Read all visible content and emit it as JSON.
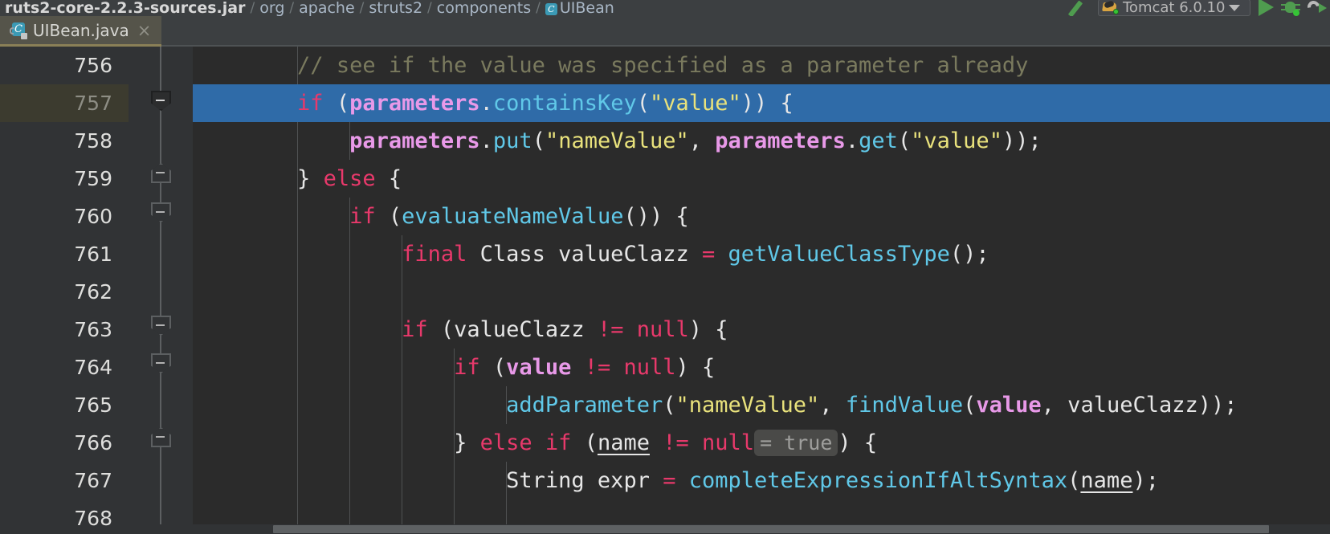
{
  "breadcrumb": {
    "items": [
      {
        "label": "ruts2-core-2.2.3-sources.jar",
        "strong": true,
        "icon": null
      },
      {
        "label": "org",
        "strong": false,
        "icon": null
      },
      {
        "label": "apache",
        "strong": false,
        "icon": null
      },
      {
        "label": "struts2",
        "strong": false,
        "icon": null
      },
      {
        "label": "components",
        "strong": false,
        "icon": null
      },
      {
        "label": "UIBean",
        "strong": false,
        "icon": "java-class-icon"
      }
    ],
    "separator": "/",
    "class_icon_glyph": "C"
  },
  "toolbar": {
    "wrench_icon": "wrench-icon",
    "run_configuration": {
      "label": "Tomcat 6.0.10",
      "icon": "tomcat-icon",
      "dropdown_arrow": "chevron-down-icon"
    },
    "run_button": "run-icon",
    "debug_button": "debug-icon",
    "rerun_button": "rerun-icon"
  },
  "tabs": [
    {
      "label": "UIBean.java",
      "icon": "java-class-readonly-icon",
      "icon_glyph": "C",
      "close": "×",
      "active": true
    }
  ],
  "editor": {
    "first_visible_line": 756,
    "current_line": 757,
    "lines": [
      {
        "number": "756",
        "fold": null,
        "indent_guides": [
          0
        ],
        "current": false,
        "tokens": [
          {
            "t": "        ",
            "c": "p"
          },
          {
            "t": "// see if the value was specified as a parameter already",
            "c": "c"
          }
        ]
      },
      {
        "number": "757",
        "fold": "down-active",
        "indent_guides": [],
        "current": true,
        "tokens": [
          {
            "t": "        ",
            "c": "p"
          },
          {
            "t": "if",
            "c": "k"
          },
          {
            "t": " (",
            "c": "p"
          },
          {
            "t": "parameters",
            "c": "fld"
          },
          {
            "t": ".",
            "c": "p"
          },
          {
            "t": "containsKey",
            "c": "m"
          },
          {
            "t": "(",
            "c": "p"
          },
          {
            "t": "\"value\"",
            "c": "s"
          },
          {
            "t": ")) {",
            "c": "p"
          }
        ]
      },
      {
        "number": "758",
        "fold": null,
        "indent_guides": [
          0,
          1
        ],
        "current": false,
        "tokens": [
          {
            "t": "            ",
            "c": "p"
          },
          {
            "t": "parameters",
            "c": "fld"
          },
          {
            "t": ".",
            "c": "p"
          },
          {
            "t": "put",
            "c": "m"
          },
          {
            "t": "(",
            "c": "p"
          },
          {
            "t": "\"nameValue\"",
            "c": "s"
          },
          {
            "t": ", ",
            "c": "p"
          },
          {
            "t": "parameters",
            "c": "fld"
          },
          {
            "t": ".",
            "c": "p"
          },
          {
            "t": "get",
            "c": "m"
          },
          {
            "t": "(",
            "c": "p"
          },
          {
            "t": "\"value\"",
            "c": "s"
          },
          {
            "t": "));",
            "c": "p"
          }
        ]
      },
      {
        "number": "759",
        "fold": "up",
        "indent_guides": [
          0
        ],
        "current": false,
        "tokens": [
          {
            "t": "        ",
            "c": "p"
          },
          {
            "t": "} ",
            "c": "p"
          },
          {
            "t": "else",
            "c": "k"
          },
          {
            "t": " {",
            "c": "p"
          }
        ]
      },
      {
        "number": "760",
        "fold": "down",
        "indent_guides": [
          0,
          1
        ],
        "current": false,
        "tokens": [
          {
            "t": "            ",
            "c": "p"
          },
          {
            "t": "if",
            "c": "k"
          },
          {
            "t": " (",
            "c": "p"
          },
          {
            "t": "evaluateNameValue",
            "c": "m"
          },
          {
            "t": "()) {",
            "c": "p"
          }
        ]
      },
      {
        "number": "761",
        "fold": null,
        "indent_guides": [
          0,
          1,
          2
        ],
        "current": false,
        "tokens": [
          {
            "t": "                ",
            "c": "p"
          },
          {
            "t": "final",
            "c": "k"
          },
          {
            "t": " Class valueClazz ",
            "c": "p"
          },
          {
            "t": "=",
            "c": "k"
          },
          {
            "t": " ",
            "c": "p"
          },
          {
            "t": "getValueClassType",
            "c": "m"
          },
          {
            "t": "();",
            "c": "p"
          }
        ]
      },
      {
        "number": "762",
        "fold": null,
        "indent_guides": [
          0,
          1,
          2
        ],
        "current": false,
        "tokens": []
      },
      {
        "number": "763",
        "fold": "down",
        "indent_guides": [
          0,
          1,
          2
        ],
        "current": false,
        "tokens": [
          {
            "t": "                ",
            "c": "p"
          },
          {
            "t": "if",
            "c": "k"
          },
          {
            "t": " (valueClazz ",
            "c": "p"
          },
          {
            "t": "!=",
            "c": "k"
          },
          {
            "t": " ",
            "c": "p"
          },
          {
            "t": "null",
            "c": "k"
          },
          {
            "t": ") {",
            "c": "p"
          }
        ]
      },
      {
        "number": "764",
        "fold": "down",
        "indent_guides": [
          0,
          1,
          2,
          3
        ],
        "current": false,
        "tokens": [
          {
            "t": "                    ",
            "c": "p"
          },
          {
            "t": "if",
            "c": "k"
          },
          {
            "t": " (",
            "c": "p"
          },
          {
            "t": "value",
            "c": "fld"
          },
          {
            "t": " ",
            "c": "p"
          },
          {
            "t": "!=",
            "c": "k"
          },
          {
            "t": " ",
            "c": "p"
          },
          {
            "t": "null",
            "c": "k"
          },
          {
            "t": ") {",
            "c": "p"
          }
        ]
      },
      {
        "number": "765",
        "fold": null,
        "indent_guides": [
          0,
          1,
          2,
          3,
          4
        ],
        "current": false,
        "tokens": [
          {
            "t": "                        ",
            "c": "p"
          },
          {
            "t": "addParameter",
            "c": "m"
          },
          {
            "t": "(",
            "c": "p"
          },
          {
            "t": "\"nameValue\"",
            "c": "s"
          },
          {
            "t": ", ",
            "c": "p"
          },
          {
            "t": "findValue",
            "c": "m"
          },
          {
            "t": "(",
            "c": "p"
          },
          {
            "t": "value",
            "c": "fld"
          },
          {
            "t": ", valueClazz));",
            "c": "p"
          }
        ]
      },
      {
        "number": "766",
        "fold": "up",
        "indent_guides": [
          0,
          1,
          2,
          3
        ],
        "current": false,
        "tokens": [
          {
            "t": "                    ",
            "c": "p"
          },
          {
            "t": "} ",
            "c": "p"
          },
          {
            "t": "else",
            "c": "k"
          },
          {
            "t": " ",
            "c": "p"
          },
          {
            "t": "if",
            "c": "k"
          },
          {
            "t": " (",
            "c": "p"
          },
          {
            "t": "name",
            "c": "u"
          },
          {
            "t": " ",
            "c": "p"
          },
          {
            "t": "!=",
            "c": "k"
          },
          {
            "t": " ",
            "c": "p"
          },
          {
            "t": "null",
            "c": "k"
          },
          {
            "t": "= true",
            "c": "hint"
          },
          {
            "t": ") {",
            "c": "p"
          }
        ]
      },
      {
        "number": "767",
        "fold": null,
        "indent_guides": [
          0,
          1,
          2,
          3,
          4
        ],
        "current": false,
        "tokens": [
          {
            "t": "                        ",
            "c": "p"
          },
          {
            "t": "String expr ",
            "c": "p"
          },
          {
            "t": "=",
            "c": "k"
          },
          {
            "t": " ",
            "c": "p"
          },
          {
            "t": "completeExpressionIfAltSyntax",
            "c": "m"
          },
          {
            "t": "(",
            "c": "p"
          },
          {
            "t": "name",
            "c": "u"
          },
          {
            "t": ");",
            "c": "p"
          }
        ]
      },
      {
        "number": "768",
        "fold": null,
        "indent_guides": [
          0,
          1,
          2,
          3,
          4
        ],
        "current": false,
        "tokens": []
      }
    ],
    "inline_hints": [
      {
        "line": 766,
        "text": "= true"
      }
    ]
  },
  "scrollbar": {
    "horizontal": "h-scrollbar-thumb"
  },
  "colors": {
    "editor_bg": "#2b2b2b",
    "gutter_bg": "#313335",
    "chrome_bg": "#3c3f41",
    "tab_active_bg": "#55544a",
    "selection_blue": "#2f6ba8",
    "current_line_gutter": "#3c3b2f",
    "keyword_pink": "#e8396b",
    "field_violet": "#e899e8",
    "method_cyan": "#60c8e8",
    "string_yellow": "#e9e27c",
    "comment_olive": "#7a7a5e",
    "plain_text": "#e6e6e6",
    "accent_green": "#4f9c4f"
  }
}
